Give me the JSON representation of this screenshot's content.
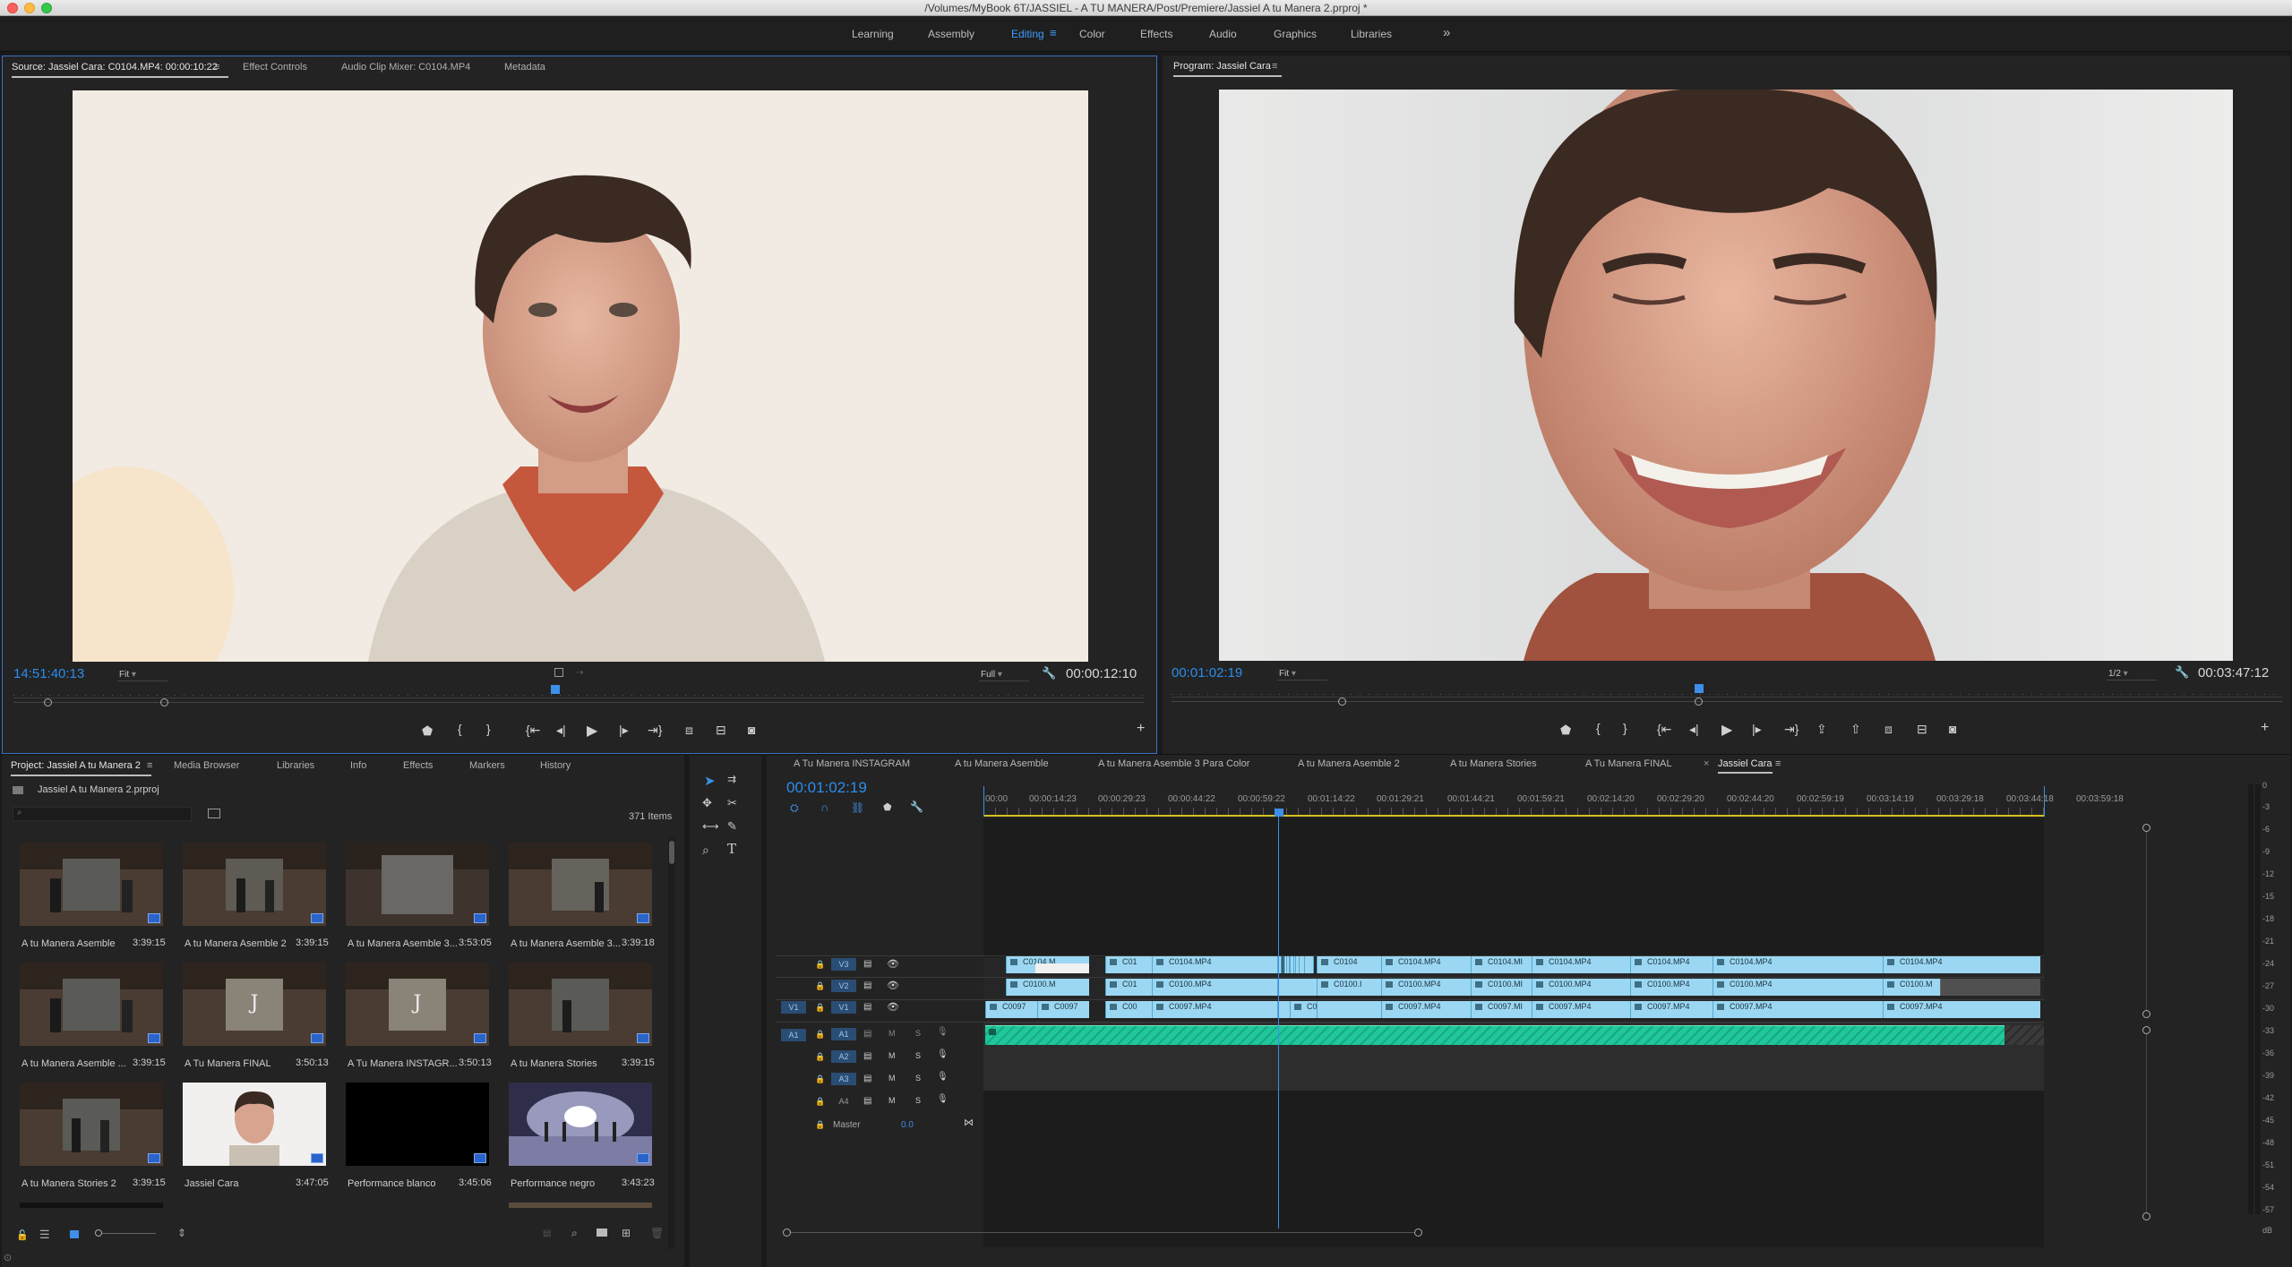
{
  "window": {
    "title": "/Volumes/MyBook 6T/JASSIEL - A TU MANERA/Post/Premiere/Jassiel A tu Manera 2.prproj *"
  },
  "workspaces": {
    "items": [
      "Learning",
      "Assembly",
      "Editing",
      "Color",
      "Effects",
      "Audio",
      "Graphics",
      "Libraries"
    ],
    "active": "Editing",
    "overflow": "»"
  },
  "source_monitor": {
    "tabs": [
      "Source: Jassiel Cara: C0104.MP4: 00:00:10:22",
      "Effect Controls",
      "Audio Clip Mixer: C0104.MP4",
      "Metadata"
    ],
    "timecode": "14:51:40:13",
    "zoom": "Fit",
    "resolution": "Full",
    "duration": "00:00:12:10"
  },
  "program_monitor": {
    "tab": "Program: Jassiel Cara",
    "timecode": "00:01:02:19",
    "zoom": "Fit",
    "resolution": "1/2",
    "duration": "00:03:47:12"
  },
  "project_panel": {
    "tabs": [
      "Project: Jassiel A tu Manera 2",
      "Media Browser",
      "Libraries",
      "Info",
      "Effects",
      "Markers",
      "History"
    ],
    "project_file": "Jassiel A tu Manera 2.prproj",
    "item_count": "371 Items",
    "items": [
      {
        "name": "A tu Manera Asemble",
        "duration": "3:39:15"
      },
      {
        "name": "A tu Manera Asemble 2",
        "duration": "3:39:15"
      },
      {
        "name": "A tu Manera Asemble 3...",
        "duration": "3:53:05"
      },
      {
        "name": "A tu Manera Asemble 3...",
        "duration": "3:39:18"
      },
      {
        "name": "A tu Manera Asemble ...",
        "duration": "3:39:15"
      },
      {
        "name": "A Tu Manera FINAL",
        "duration": "3:50:13"
      },
      {
        "name": "A Tu Manera INSTAGR...",
        "duration": "3:50:13"
      },
      {
        "name": "A tu Manera Stories",
        "duration": "3:39:15"
      },
      {
        "name": "A tu Manera Stories 2",
        "duration": "3:39:15"
      },
      {
        "name": "Jassiel Cara",
        "duration": "3:47:05"
      },
      {
        "name": "Performance blanco",
        "duration": "3:45:06"
      },
      {
        "name": "Performance negro",
        "duration": "3:43:23"
      }
    ]
  },
  "timeline": {
    "sequence_tabs": [
      "A Tu Manera INSTAGRAM",
      "A tu Manera Asemble",
      "A tu Manera Asemble 3 Para Color",
      "A tu Manera Asemble 2",
      "A tu Manera Stories",
      "A Tu Manera FINAL",
      "Jassiel Cara"
    ],
    "active_sequence": "Jassiel Cara",
    "timecode": "00:01:02:19",
    "ruler_labels": [
      "00:00",
      "00:00:14:23",
      "00:00:29:23",
      "00:00:44:22",
      "00:00:59:22",
      "00:01:14:22",
      "00:01:29:21",
      "00:01:44:21",
      "00:01:59:21",
      "00:02:14:20",
      "00:02:29:20",
      "00:02:44:20",
      "00:02:59:19",
      "00:03:14:19",
      "00:03:29:18",
      "00:03:44:18",
      "00:03:59:18"
    ],
    "video_tracks": [
      "V3",
      "V2",
      "V1"
    ],
    "audio_tracks": [
      "A1",
      "A2",
      "A3",
      "A4"
    ],
    "source_patch_video": "V1",
    "source_patch_audio": "A1",
    "master_label": "Master",
    "master_value": "0.0",
    "track_buttons": {
      "mute": "M",
      "solo": "S"
    },
    "v3_clips": [
      "C0104.M",
      "C01",
      "C0104.MP4",
      "C0104",
      "C0104.MP4",
      "C0104.MI",
      "C0104.MP4",
      "C0104.MP4",
      "C0104.MP4",
      "C0104.MP4"
    ],
    "v2_clips": [
      "C0100.M",
      "C01",
      "C0100.MP4",
      "C0100.I",
      "C0100.MP4",
      "C0100.MI",
      "C0100.MP4",
      "C0100.MP4",
      "C0100.MP4",
      "C0100.M"
    ],
    "v1_clips": [
      "C0097",
      "C0097",
      "C00",
      "C0097.MP4",
      "C0097",
      "C0097.MP4",
      "C0097.MI",
      "C0097.MP4",
      "C0097.MP4",
      "C0097.MP4",
      "C0097.MP4"
    ]
  },
  "audio_meter": {
    "labels": [
      "0",
      "-3",
      "-6",
      "-9",
      "-12",
      "-15",
      "-18",
      "-21",
      "-24",
      "-27",
      "-30",
      "-33",
      "-36",
      "-39",
      "-42",
      "-45",
      "-48",
      "-51",
      "-54",
      "-57",
      "dB"
    ]
  },
  "colors": {
    "accent_blue": "#2d8ceb",
    "clip_video": "#9bd7f2",
    "clip_audio": "#1fc79a",
    "panel_bg": "#232323"
  }
}
